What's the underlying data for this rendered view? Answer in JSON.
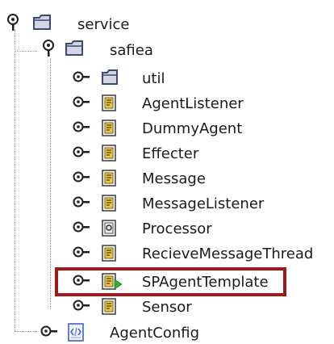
{
  "tree": {
    "root": {
      "label": "service",
      "state": "expanded",
      "icon": "folder-icon"
    },
    "package": {
      "label": "safiea",
      "state": "expanded",
      "icon": "folder-icon"
    },
    "children": [
      {
        "label": "util",
        "state": "collapsed",
        "icon": "folder-icon"
      },
      {
        "label": "AgentListener",
        "state": "collapsed",
        "icon": "java-class-icon"
      },
      {
        "label": "DummyAgent",
        "state": "collapsed",
        "icon": "java-class-icon"
      },
      {
        "label": "Effecter",
        "state": "collapsed",
        "icon": "java-class-icon"
      },
      {
        "label": "Message",
        "state": "collapsed",
        "icon": "java-class-icon"
      },
      {
        "label": "MessageListener",
        "state": "collapsed",
        "icon": "java-class-icon"
      },
      {
        "label": "Processor",
        "state": "collapsed",
        "icon": "java-interface-icon"
      },
      {
        "label": "RecieveMessageThread",
        "state": "collapsed",
        "icon": "java-class-icon"
      },
      {
        "label": "SPAgentTemplate",
        "state": "collapsed",
        "icon": "java-class-run-icon",
        "highlighted": true
      },
      {
        "label": "Sensor",
        "state": "collapsed",
        "icon": "java-class-icon"
      }
    ],
    "sibling": {
      "label": "AgentConfig",
      "state": "collapsed",
      "icon": "config-file-icon"
    }
  },
  "colors": {
    "highlight_border": "#a01818",
    "folder_fill": "#d4d7e3",
    "folder_stroke": "#3a4a72",
    "class_fill": "#e6c84a",
    "run_arrow": "#2fb33a"
  }
}
